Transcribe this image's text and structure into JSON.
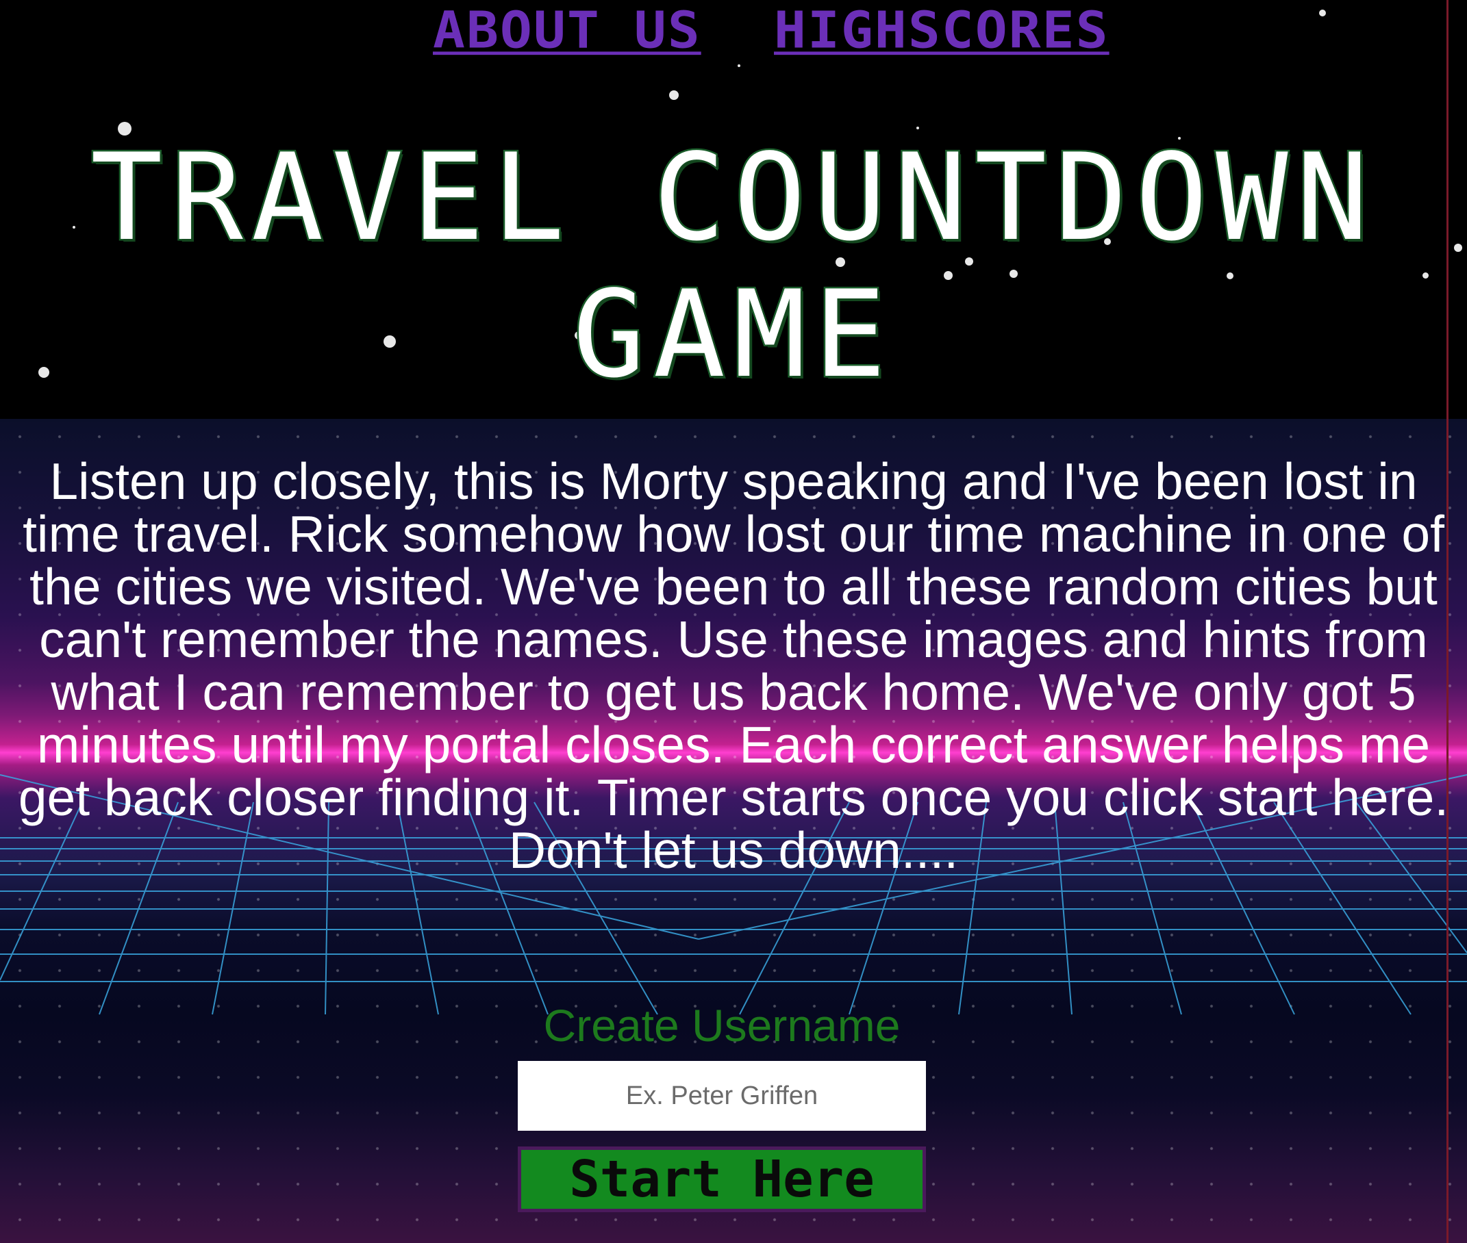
{
  "nav": {
    "about_label": "ABOUT US",
    "highscores_label": "HIGHSCORES"
  },
  "title": "TRAVEL COUNTDOWN GAME",
  "story": "Listen up closely, this is Morty speaking and I've been lost in time travel. Rick somehow how lost our time machine in one of the cities we visited. We've been to all these random cities but can't remember the names. Use these images and hints from what I can remember to get us back home. We've only got 5 minutes until my portal closes. Each correct answer helps me get back closer finding it. Timer starts once you click start here. Don't let us down....",
  "form": {
    "label": "Create Username",
    "placeholder": "Ex. Peter Griffen",
    "start_label": "Start Here"
  },
  "colors": {
    "nav_link": "#6b2fb8",
    "title_outline": "#1a5c2a",
    "label_green": "#1d7a1d",
    "button_green": "#138a1f",
    "button_border": "#4b1a5c",
    "grid_line": "#3aa7e0",
    "horizon_glow": "#ff3fd0"
  }
}
